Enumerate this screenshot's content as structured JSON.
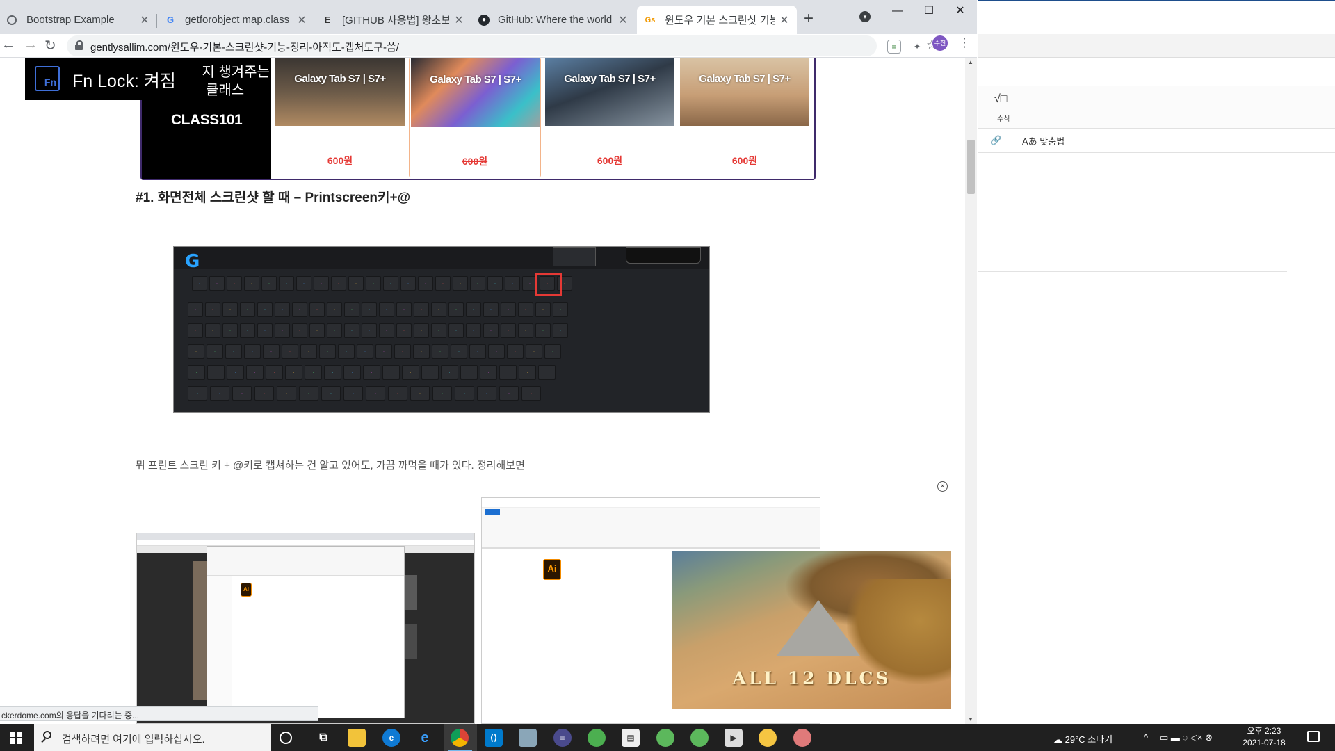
{
  "browser": {
    "tabs": [
      {
        "title": "Bootstrap Example",
        "favicon": "globe-icon"
      },
      {
        "title": "getforobject map.class - Goog",
        "favicon": "google-icon"
      },
      {
        "title": "[GITHUB 사용법] 왕초보를 위한",
        "favicon": "e-icon"
      },
      {
        "title": "GitHub: Where the world build",
        "favicon": "github-icon"
      },
      {
        "title": "윈도우 기본 스크린샷 기능 정",
        "favicon": "site-icon"
      }
    ],
    "new_tab": "+",
    "url": "gentlysallim.com/윈도우-기본-스크린샷-기능-정리-아직도-캡처도구-씀/",
    "profile_initials": "수진",
    "status_text": "ckerdome.com의 응답을 기다리는 중..."
  },
  "page": {
    "fnlock_text": "Fn Lock: 켜짐",
    "fnlock_icon": "Fn",
    "ad": {
      "line1": "가지 챙겨주는",
      "line2": "인 클래스",
      "logo": "CLASS101",
      "menu": "=",
      "products": [
        {
          "label": "Galaxy Tab S7 | S7+",
          "price": "600원"
        },
        {
          "label": "Galaxy Tab S7 | S7+",
          "price": "600원"
        },
        {
          "label": "Galaxy Tab S7 | S7+",
          "price": "600원"
        },
        {
          "label": "Galaxy Tab S7 | S7+",
          "price": "600원"
        }
      ]
    },
    "heading": "#1. 화면전체 스크린샷 할 때 – Printscreen키+@",
    "paragraph": "뭐 프린트 스크린 키 + @키로 캡쳐하는 건 알고 있어도, 가끔 까먹을 때가 있다. 정리해보면",
    "video_caption": "ALL 12 DLCS",
    "video_close": "×"
  },
  "bg_app": {
    "equation_label": "수식",
    "equation_icon": "√□",
    "spell_label": "맞춤법"
  },
  "taskbar": {
    "search_placeholder": "검색하려면 여기에 입력하십시오.",
    "weather": "29°C 소나기",
    "time": "오후 2:23",
    "date": "2021-07-18"
  },
  "colors": {
    "accent_purple": "#3f2a6b",
    "price_red": "#e53935",
    "taskbar": "#202020"
  }
}
